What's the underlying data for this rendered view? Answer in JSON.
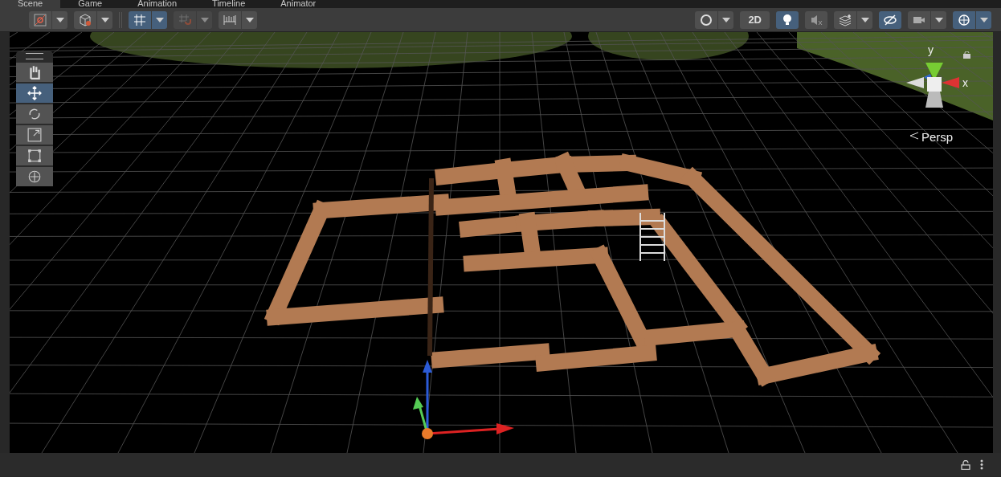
{
  "tabs": [
    {
      "label": "Scene",
      "selected": true
    },
    {
      "label": "Game",
      "selected": false
    },
    {
      "label": "Animation",
      "selected": false
    },
    {
      "label": "Timeline",
      "selected": false
    },
    {
      "label": "Animator",
      "selected": false
    }
  ],
  "toolbar_left": [
    {
      "kind": "split",
      "on": false
    },
    {
      "kind": "split",
      "on": false
    },
    {
      "kind": "split",
      "on": true
    },
    {
      "kind": "split",
      "on": false,
      "disabled": true
    },
    {
      "kind": "split",
      "on": false
    }
  ],
  "toolbar_right": [
    {
      "kind": "split",
      "on": false
    },
    {
      "kind": "text",
      "label": "2D",
      "on": false
    },
    {
      "kind": "button",
      "on": true
    },
    {
      "kind": "button",
      "on": false
    },
    {
      "kind": "split",
      "on": false
    },
    {
      "kind": "button",
      "on": true
    },
    {
      "kind": "split",
      "on": false
    },
    {
      "kind": "split",
      "on": true
    }
  ],
  "tools": [
    {
      "selected": false
    },
    {
      "selected": true
    },
    {
      "selected": false
    },
    {
      "selected": false
    },
    {
      "selected": false
    },
    {
      "selected": false
    }
  ],
  "orientation_gizmo": {
    "y_label": "y",
    "x_label": "x",
    "projection": "Persp"
  }
}
